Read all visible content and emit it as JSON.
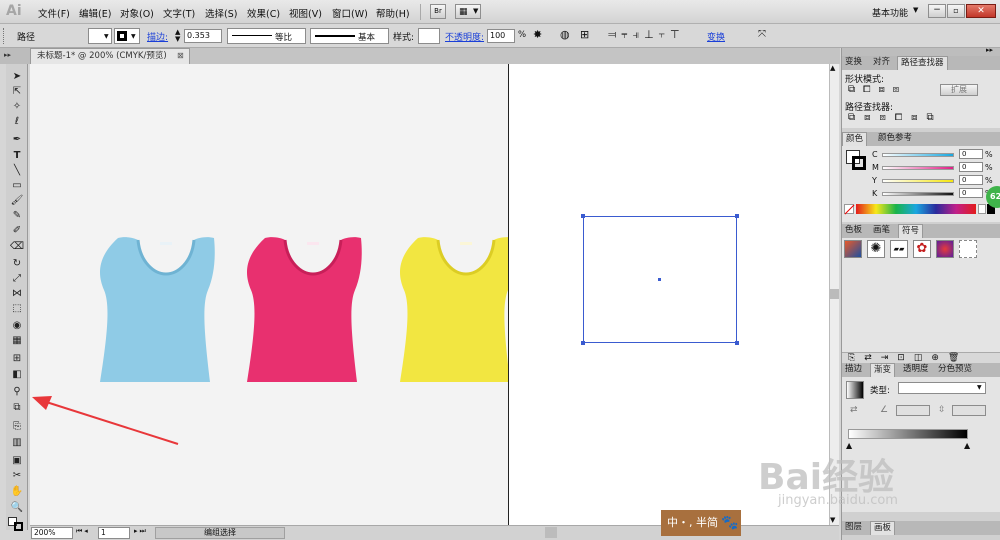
{
  "app": {
    "logo": "Ai"
  },
  "menu": [
    "文件(F)",
    "编辑(E)",
    "对象(O)",
    "文字(T)",
    "选择(S)",
    "效果(C)",
    "视图(V)",
    "窗口(W)",
    "帮助(H)"
  ],
  "menu_right": {
    "bridge": "Br",
    "workspace": "基本功能"
  },
  "control_bar": {
    "selection": "路径",
    "stroke_label": "描边:",
    "stroke_value": "0.353",
    "profile_label": "等比",
    "brush_label": "基本",
    "style_label": "样式:",
    "opacity_label": "不透明度:",
    "opacity_value": "100",
    "opacity_unit": "%",
    "transform_label": "变换"
  },
  "document": {
    "tab_title": "未标题-1* @ 200% (CMYK/预览)",
    "shirt_colors": [
      "#8fcbe6",
      "#e8306f",
      "#f2e641"
    ]
  },
  "status_bar": {
    "zoom": "200%",
    "page": "1",
    "tool_status": "编组选择"
  },
  "panels": {
    "pathfinder": {
      "tabs": [
        "变换",
        "对齐",
        "路径查找器"
      ],
      "shape_modes": "形状模式:",
      "expand": "扩展",
      "pathfinders": "路径查找器:"
    },
    "color": {
      "tabs": [
        "颜色",
        "颜色参考"
      ],
      "channels": [
        {
          "label": "C",
          "value": "0",
          "unit": "%",
          "color": "#19a7df"
        },
        {
          "label": "M",
          "value": "0",
          "unit": "%",
          "color": "#e01f86"
        },
        {
          "label": "Y",
          "value": "0",
          "unit": "%",
          "color": "#f5e60e"
        },
        {
          "label": "K",
          "value": "0",
          "unit": "%",
          "color": "#111111"
        }
      ]
    },
    "symbols": {
      "tabs": [
        "色板",
        "画笔",
        "符号"
      ]
    },
    "gradient": {
      "tabs": [
        "描边",
        "渐变",
        "透明度",
        "分色预览"
      ],
      "type_label": "类型:"
    },
    "layers": {
      "tabs": [
        "图层",
        "画板"
      ]
    }
  },
  "badge": "62",
  "ime": "中・, 半简",
  "watermark": {
    "logo": "Bai经验",
    "url": "jingyan.baidu.com"
  },
  "annotation_color": "#e8373a"
}
